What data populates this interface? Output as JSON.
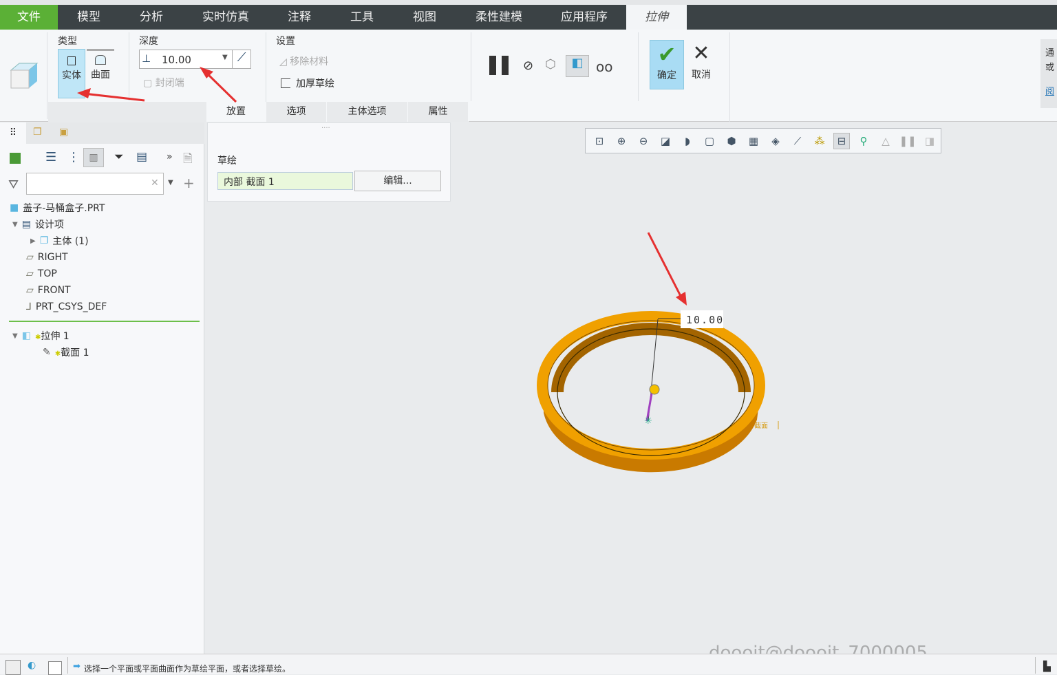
{
  "menu": {
    "tabs": [
      "文件",
      "模型",
      "分析",
      "实时仿真",
      "注释",
      "工具",
      "视图",
      "柔性建模",
      "应用程序",
      "拉伸"
    ]
  },
  "ribbon": {
    "type": {
      "title": "类型",
      "solid": "实体",
      "surface": "曲面"
    },
    "depth": {
      "title": "深度",
      "value": "10.00",
      "capped": "封闭端"
    },
    "settings": {
      "title": "设置",
      "remove_material": "移除材料",
      "thicken": "加厚草绘"
    },
    "confirm": "确定",
    "cancel": "取消",
    "tabs": [
      "放置",
      "选项",
      "主体选项",
      "属性"
    ],
    "side_hint": [
      "通",
      "或",
      "阅"
    ]
  },
  "tree": {
    "search_placeholder": "",
    "items": [
      {
        "label": "盖子-马桶盒子.PRT",
        "icon": "part-icon"
      },
      {
        "label": "设计项",
        "icon": "design-items-icon"
      },
      {
        "label": "主体 (1)",
        "icon": "body-icon"
      },
      {
        "label": "RIGHT",
        "icon": "datum-plane-icon"
      },
      {
        "label": "TOP",
        "icon": "datum-plane-icon"
      },
      {
        "label": "FRONT",
        "icon": "datum-plane-icon"
      },
      {
        "label": "PRT_CSYS_DEF",
        "icon": "csys-icon"
      },
      {
        "label": "拉伸 1",
        "icon": "extrude-icon"
      },
      {
        "label": "截面 1",
        "icon": "sketch-icon"
      }
    ]
  },
  "placement": {
    "label": "草绘",
    "section": "内部 截面 1",
    "edit": "编辑..."
  },
  "viewport": {
    "dimension": "10.00",
    "section_label": "截面",
    "part_color": "#f0a000"
  },
  "status": {
    "message": "选择一个平面或平面曲面作为草绘平面，或者选择草绘。"
  },
  "watermark": "doooit@doooit_7000005",
  "colors": {
    "file_tab": "#5bb036",
    "menubar": "#3b4245",
    "selected": "#bfe6f7"
  }
}
